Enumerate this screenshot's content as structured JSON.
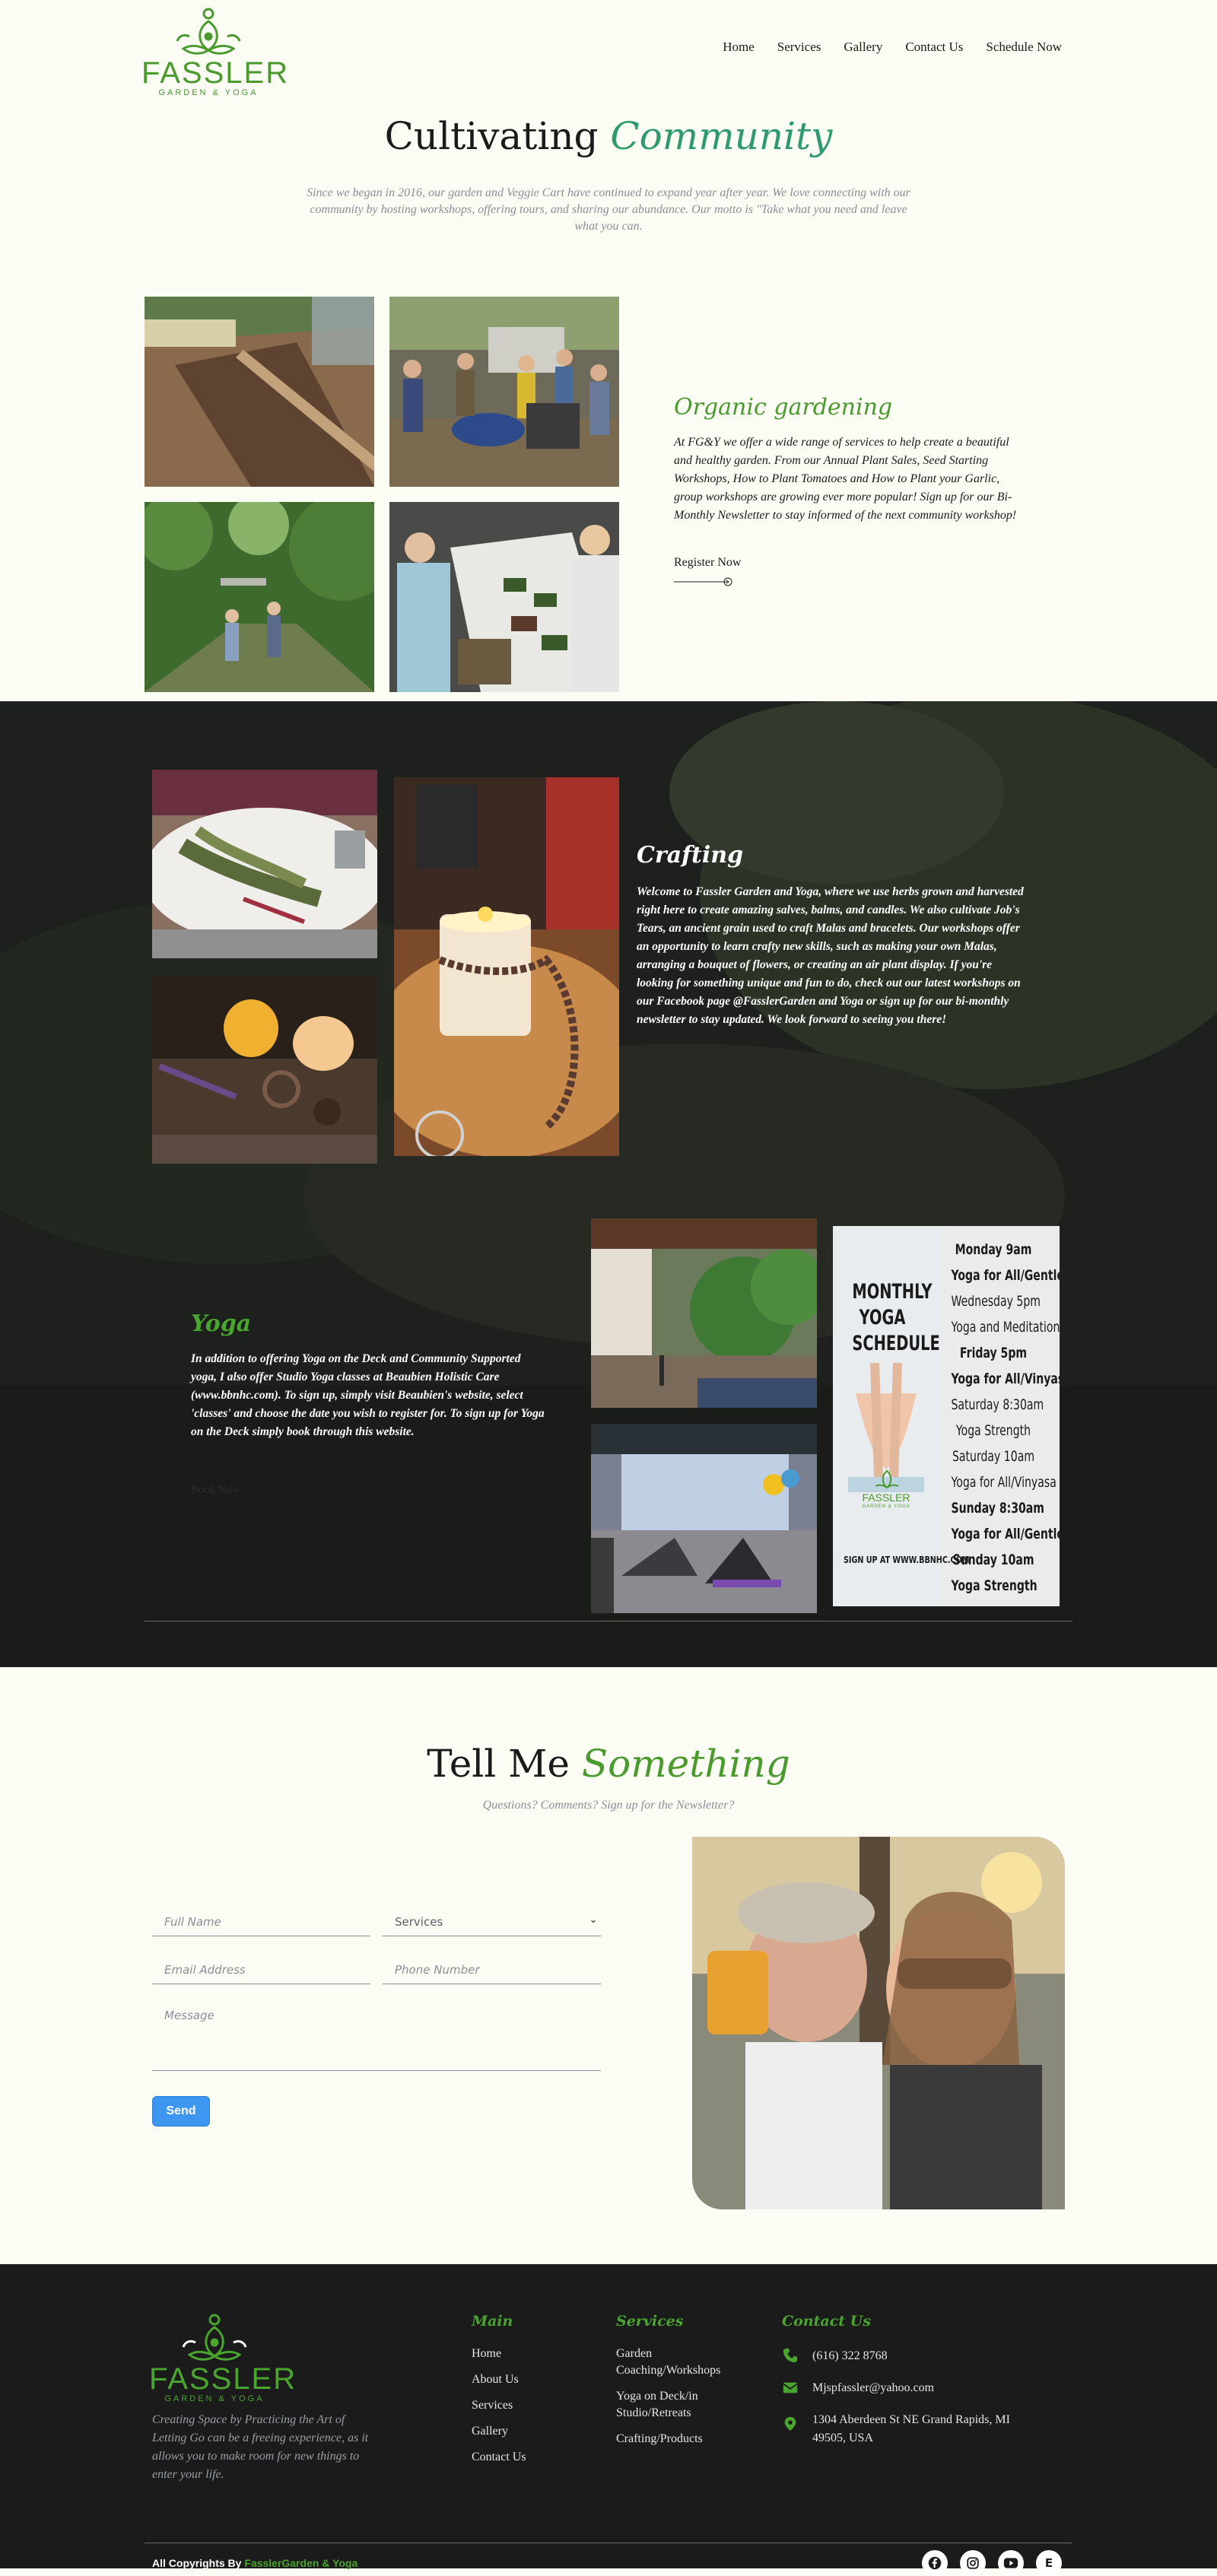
{
  "brand": {
    "name": "FASSLER",
    "sub": "GARDEN & YOGA"
  },
  "nav": [
    {
      "label": "Home"
    },
    {
      "label": "Services"
    },
    {
      "label": "Gallery"
    },
    {
      "label": "Contact Us"
    },
    {
      "label": "Schedule Now"
    }
  ],
  "intro": {
    "title_plain": "Cultivating ",
    "title_em": "Community",
    "paragraph": "Since we began in 2016, our garden and Veggie Cart have continued to expand year after year. We love connecting with our community by hosting workshops, offering tours, and sharing our abundance. Our motto is \"Take what you need and leave what you can."
  },
  "organic": {
    "title": "Organic gardening",
    "text": "At FG&Y we offer a wide range of services to help create a beautiful and healthy garden.  From our Annual Plant Sales, Seed Starting Workshops, How to Plant Tomatoes and How to Plant your Garlic, group workshops are growing ever more popular!  Sign up for our Bi-Monthly Newsletter to stay informed of the next community workshop!",
    "link": "Register Now"
  },
  "crafting": {
    "title": "Crafting",
    "text": "Welcome to Fassler Garden and Yoga, where we use herbs grown and harvested right here to create amazing salves, balms, and candles. We also cultivate Job's Tears, an ancient grain used to craft Malas and bracelets. Our workshops offer an opportunity to learn crafty new skills, such as making your own Malas, arranging a bouquet of flowers, or creating an air plant display. If you're looking for something unique and fun to do, check out our latest workshops on our Facebook page @FasslerGarden and Yoga or sign up for our bi-monthly newsletter to stay updated. We look forward to seeing you there!"
  },
  "yoga": {
    "title": "Yoga",
    "text": "In addition to offering Yoga on the Deck and Community Supported yoga, I also offer Studio Yoga classes at Beaubien Holistic Care (www.bbnhc.com). To sign up, simply visit Beaubien's website, select 'classes' and choose the date you wish to register for. To sign up for Yoga on the Deck simply book through this website.",
    "link": "Book Now"
  },
  "schedule": {
    "title": "MONTHLY YOGA SCHEDULE",
    "lines": [
      {
        "text": "Monday 9am",
        "bold": true
      },
      {
        "text": "Yoga for All/Gentle",
        "bold": true
      },
      {
        "text": "Wednesday 5pm",
        "bold": false
      },
      {
        "text": "Yoga and Meditation",
        "bold": false
      },
      {
        "text": "Friday 5pm",
        "bold": true
      },
      {
        "text": "Yoga for All/Vinyasa",
        "bold": true
      },
      {
        "text": "Saturday 8:30am",
        "bold": false
      },
      {
        "text": "Yoga Strength",
        "bold": false
      },
      {
        "text": "Saturday 10am",
        "bold": false
      },
      {
        "text": "Yoga for All/Vinyasa",
        "bold": false
      },
      {
        "text": "Sunday 8:30am",
        "bold": true
      },
      {
        "text": "Yoga for All/Gentle",
        "bold": true
      },
      {
        "text": "Sunday 10am",
        "bold": true
      },
      {
        "text": "Yoga Strength",
        "bold": true
      }
    ],
    "signup": "SIGN UP AT WWW.BBNHC.COM",
    "logo_brand": "FASSLER",
    "logo_sub": "GARDEN & YOGA"
  },
  "contact": {
    "title_plain": "Tell Me ",
    "title_em": "Something",
    "subtitle": "Questions?  Comments?  Sign up for the Newsletter?",
    "full_name": "Full Name",
    "services": "Services",
    "email": "Email Address",
    "phone": "Phone Number",
    "message": "Message",
    "send": "Send"
  },
  "footer": {
    "brand": "FASSLER",
    "sub": "GARDEN & YOGA",
    "tagline": "Creating Space by Practicing the Art of Letting Go can be a freeing experience, as it allows you to make room for new things to enter your life.",
    "main_title": "Main",
    "main_links": [
      "Home",
      "About Us",
      "Services",
      "Gallery",
      "Contact Us"
    ],
    "services_title": "Services",
    "services_links": [
      "Garden Coaching/Workshops",
      "Yoga on Deck/in Studio/Retreats",
      "Crafting/Products"
    ],
    "contact_title": "Contact Us",
    "phone": "(616) 322 8768",
    "email": "Mjspfassler@yahoo.com",
    "address": "1304 Aberdeen St NE Grand Rapids, MI 49505, USA",
    "copyright_prefix": "All Copyrights By ",
    "copyright_link": "FasslerGarden & Yoga"
  },
  "colors": {
    "brand_green": "#4a9a2e",
    "teal_accent": "#2e9a6e",
    "send_blue": "#3d97f0",
    "dark_bg": "#1b1d1b",
    "page_bg": "#fbfcf4"
  },
  "icons": [
    "lotus-logo-icon",
    "arrow-circle-icon",
    "chevron-down-icon",
    "phone-icon",
    "envelope-icon",
    "location-pin-icon",
    "facebook-icon",
    "instagram-icon",
    "youtube-icon",
    "etsy-icon"
  ]
}
